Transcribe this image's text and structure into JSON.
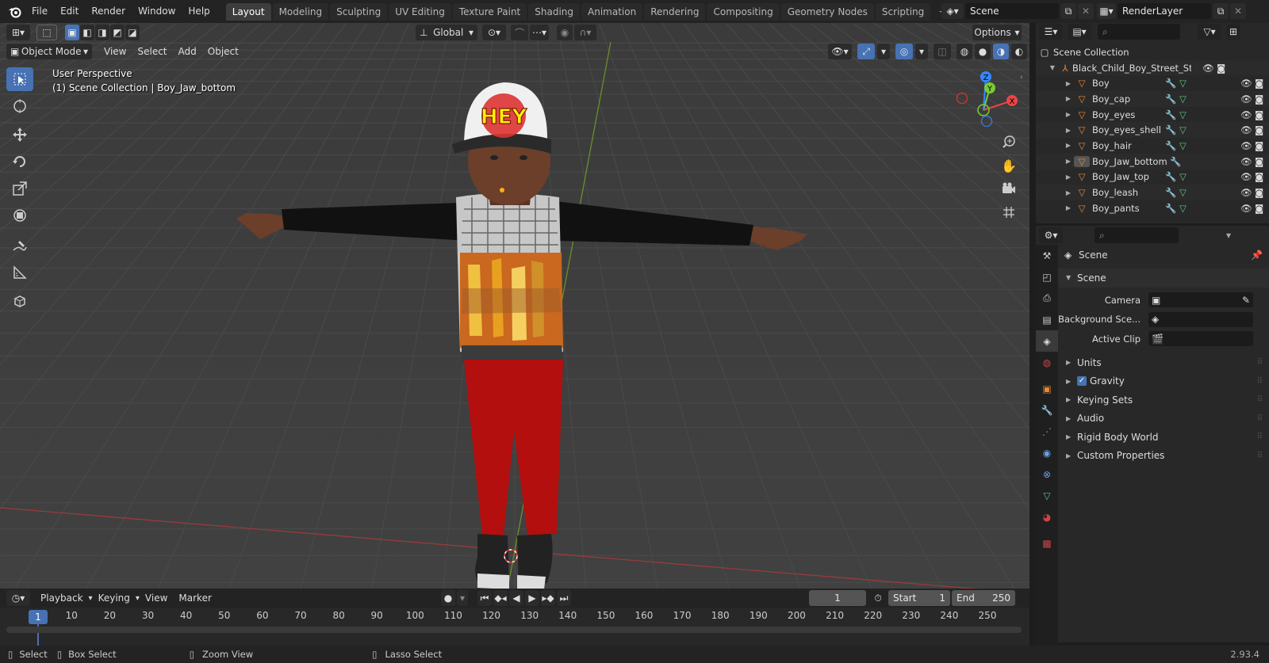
{
  "topbar": {
    "menus": [
      "File",
      "Edit",
      "Render",
      "Window",
      "Help"
    ],
    "workspaces": [
      "Layout",
      "Modeling",
      "Sculpting",
      "UV Editing",
      "Texture Paint",
      "Shading",
      "Animation",
      "Rendering",
      "Compositing",
      "Geometry Nodes",
      "Scripting"
    ],
    "active_workspace": "Layout",
    "scene_name": "Scene",
    "view_layer": "RenderLayer"
  },
  "viewport": {
    "transform_orientation": "Global",
    "options_label": "Options",
    "mode": "Object Mode",
    "header_menus": [
      "View",
      "Select",
      "Add",
      "Object"
    ],
    "perspective_text": "User Perspective",
    "context_text": "(1) Scene Collection | Boy_Jaw_bottom",
    "cap_text": "HEY",
    "gizmo_axes": {
      "x": "X",
      "y": "Y",
      "z": "Z"
    }
  },
  "outliner": {
    "root": "Scene Collection",
    "collection": "Black_Child_Boy_Street_Style",
    "objects": [
      {
        "name": "Boy",
        "has_mesh": true
      },
      {
        "name": "Boy_cap",
        "has_mesh": true
      },
      {
        "name": "Boy_eyes",
        "has_mesh": true
      },
      {
        "name": "Boy_eyes_shell",
        "has_mesh": true
      },
      {
        "name": "Boy_hair",
        "has_mesh": true
      },
      {
        "name": "Boy_Jaw_bottom",
        "has_mesh": false,
        "active": true
      },
      {
        "name": "Boy_Jaw_top",
        "has_mesh": true
      },
      {
        "name": "Boy_leash",
        "has_mesh": true
      },
      {
        "name": "Boy_pants",
        "has_mesh": true
      }
    ]
  },
  "properties": {
    "context_name": "Scene",
    "panel_title": "Scene",
    "fields": [
      {
        "label": "Camera",
        "value": ""
      },
      {
        "label": "Background Sce...",
        "value": ""
      },
      {
        "label": "Active Clip",
        "value": ""
      }
    ],
    "subpanels": [
      "Units",
      "Gravity",
      "Keying Sets",
      "Audio",
      "Rigid Body World",
      "Custom Properties"
    ],
    "gravity_checked": true
  },
  "timeline": {
    "menus": [
      "Playback",
      "Keying",
      "View",
      "Marker"
    ],
    "current_frame": "1",
    "start_label": "Start",
    "start_value": "1",
    "end_label": "End",
    "end_value": "250",
    "ticks": [
      "10",
      "20",
      "30",
      "40",
      "50",
      "60",
      "70",
      "80",
      "90",
      "100",
      "110",
      "120",
      "130",
      "140",
      "150",
      "160",
      "170",
      "180",
      "190",
      "200",
      "210",
      "220",
      "230",
      "240",
      "250"
    ],
    "playhead_label": "1"
  },
  "status": {
    "select": "Select",
    "box_select": "Box Select",
    "zoom_view": "Zoom View",
    "lasso_select": "Lasso Select",
    "version": "2.93.4"
  },
  "colors": {
    "accent": "#4772b3",
    "active_tab": "#3d3d3d",
    "object_orange": "#e8893a",
    "mesh_green": "#5fc47a",
    "modifier_blue": "#6aa1e3"
  }
}
